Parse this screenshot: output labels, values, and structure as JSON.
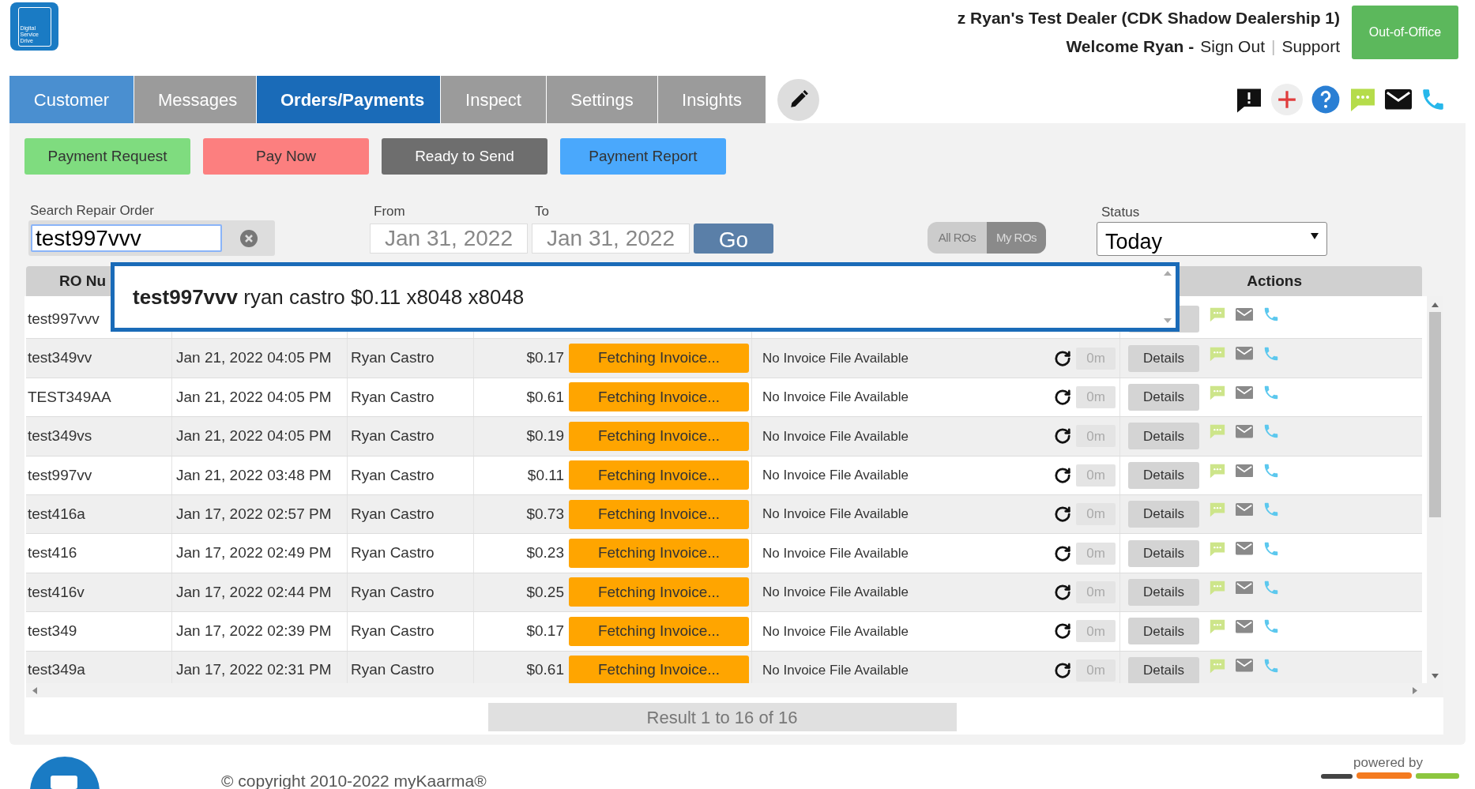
{
  "header": {
    "logo_text": [
      "Digital",
      "Service",
      "Drive"
    ],
    "dealer": "z Ryan's Test Dealer (CDK Shadow Dealership 1)",
    "welcome": "Welcome Ryan -",
    "sign_out": "Sign Out",
    "separator": "|",
    "support": "Support",
    "out_of_office": "Out-of-Office"
  },
  "tabs": [
    {
      "label": "Customer",
      "selected": false,
      "color": "#4a8fd0"
    },
    {
      "label": "Messages",
      "selected": false,
      "color": "#9b9b9b"
    },
    {
      "label": "Orders/Payments",
      "selected": true,
      "color": "#1a6bb8"
    },
    {
      "label": "Inspect",
      "selected": false,
      "color": "#9b9b9b"
    },
    {
      "label": "Settings",
      "selected": false,
      "color": "#9b9b9b"
    },
    {
      "label": "Insights",
      "selected": false,
      "color": "#9b9b9b"
    }
  ],
  "action_buttons": [
    {
      "label": "Payment Request",
      "color": "#7fdc7f",
      "dark": false
    },
    {
      "label": "Pay Now",
      "color": "#fc7f7f",
      "dark": false
    },
    {
      "label": "Ready to Send",
      "color": "#6e6e6e",
      "dark": true
    },
    {
      "label": "Payment Report",
      "color": "#4aa8fc",
      "dark": false
    }
  ],
  "search": {
    "label": "Search Repair Order",
    "value": "test997vvv"
  },
  "date_from": {
    "label": "From",
    "value": "Jan 31, 2022"
  },
  "date_to": {
    "label": "To",
    "value": "Jan 31, 2022"
  },
  "go_button": "Go",
  "ro_toggle": [
    {
      "label": "All ROs",
      "selected": false
    },
    {
      "label": "My ROs",
      "selected": true
    }
  ],
  "status": {
    "label": "Status",
    "value": "Today"
  },
  "table": {
    "columns": [
      "RO Nu",
      "Actions"
    ],
    "rows": [
      {
        "ro": "test997vvv"
      },
      {
        "ro": "test349vv",
        "date": "Jan 21, 2022 04:05 PM",
        "name": "Ryan Castro",
        "amount": "$0.17",
        "status": "Fetching Invoice...",
        "invoice": "No Invoice File Available",
        "age": "0m",
        "details": "Details"
      },
      {
        "ro": "TEST349AA",
        "date": "Jan 21, 2022 04:05 PM",
        "name": "Ryan Castro",
        "amount": "$0.61",
        "status": "Fetching Invoice...",
        "invoice": "No Invoice File Available",
        "age": "0m",
        "details": "Details"
      },
      {
        "ro": "test349vs",
        "date": "Jan 21, 2022 04:05 PM",
        "name": "Ryan Castro",
        "amount": "$0.19",
        "status": "Fetching Invoice...",
        "invoice": "No Invoice File Available",
        "age": "0m",
        "details": "Details"
      },
      {
        "ro": "test997vv",
        "date": "Jan 21, 2022 03:48 PM",
        "name": "Ryan Castro",
        "amount": "$0.11",
        "status": "Fetching Invoice...",
        "invoice": "No Invoice File Available",
        "age": "0m",
        "details": "Details"
      },
      {
        "ro": "test416a",
        "date": "Jan 17, 2022 02:57 PM",
        "name": "Ryan Castro",
        "amount": "$0.73",
        "status": "Fetching Invoice...",
        "invoice": "No Invoice File Available",
        "age": "0m",
        "details": "Details"
      },
      {
        "ro": "test416",
        "date": "Jan 17, 2022 02:49 PM",
        "name": "Ryan Castro",
        "amount": "$0.23",
        "status": "Fetching Invoice...",
        "invoice": "No Invoice File Available",
        "age": "0m",
        "details": "Details"
      },
      {
        "ro": "test416v",
        "date": "Jan 17, 2022 02:44 PM",
        "name": "Ryan Castro",
        "amount": "$0.25",
        "status": "Fetching Invoice...",
        "invoice": "No Invoice File Available",
        "age": "0m",
        "details": "Details"
      },
      {
        "ro": "test349",
        "date": "Jan 17, 2022 02:39 PM",
        "name": "Ryan Castro",
        "amount": "$0.17",
        "status": "Fetching Invoice...",
        "invoice": "No Invoice File Available",
        "age": "0m",
        "details": "Details"
      },
      {
        "ro": "test349a",
        "date": "Jan 17, 2022 02:31 PM",
        "name": "Ryan Castro",
        "amount": "$0.61",
        "status": "Fetching Invoice...",
        "invoice": "No Invoice File Available",
        "age": "0m",
        "details": "Details"
      }
    ]
  },
  "suggestion": "**test997vvv** ryan castro $0.11 x8048 x8048",
  "result": "Result 1 to 16 of 16",
  "footer": {
    "copyright": "© copyright 2010-2022 myKaarma®",
    "powered_by": "powered by"
  }
}
